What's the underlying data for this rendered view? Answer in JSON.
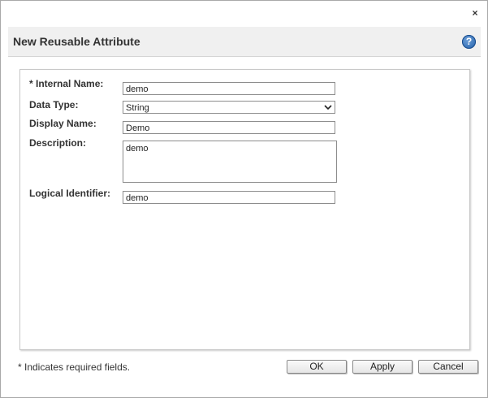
{
  "window": {
    "close_label": "×"
  },
  "header": {
    "title": "New Reusable Attribute",
    "help_label": "?"
  },
  "form": {
    "internal_name": {
      "required_mark": "*",
      "label": "Internal Name:",
      "value": "demo"
    },
    "data_type": {
      "label": "Data Type:",
      "value": "String"
    },
    "display_name": {
      "label": "Display Name:",
      "value": "Demo"
    },
    "description": {
      "label": "Description:",
      "value": "demo"
    },
    "logical_identifier": {
      "label": "Logical Identifier:",
      "value": "demo"
    }
  },
  "footer": {
    "required_note": "* Indicates required fields.",
    "ok_label": "OK",
    "apply_label": "Apply",
    "cancel_label": "Cancel"
  },
  "icons": {
    "close": "close-icon",
    "help": "help-icon",
    "dropdown": "chevron-down-icon"
  },
  "colors": {
    "header_bg": "#f0f0f0",
    "help_icon": "#1d5ca8",
    "border": "#8d8d8d"
  }
}
